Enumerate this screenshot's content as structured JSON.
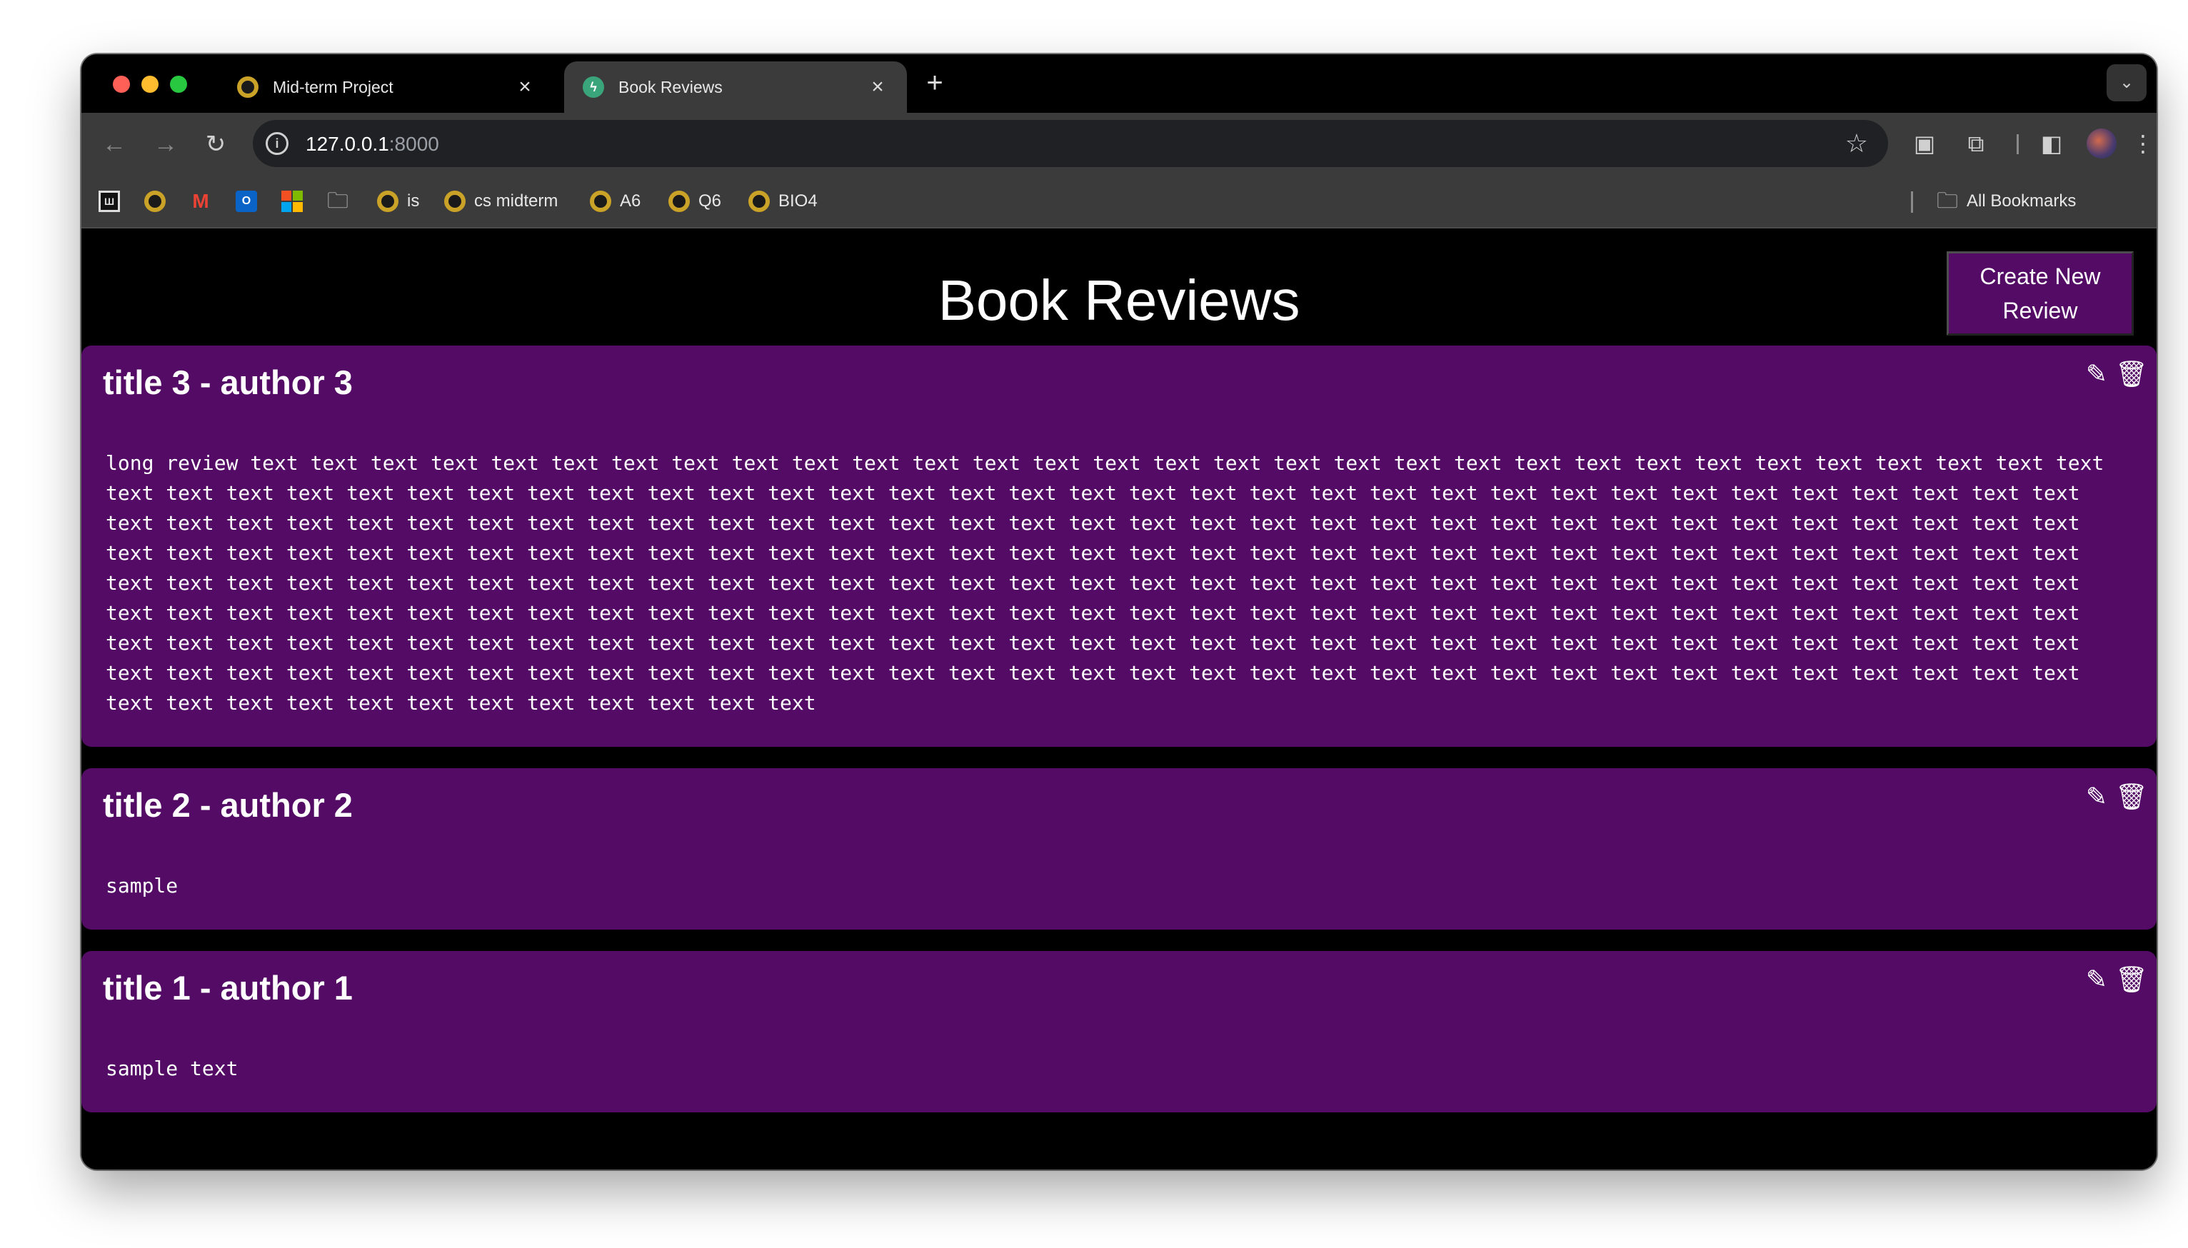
{
  "browser": {
    "tabs": [
      {
        "label": "Mid-term Project",
        "active": false,
        "icon": "ring-logo-icon"
      },
      {
        "label": "Book Reviews",
        "active": true,
        "icon": "bolt-icon"
      }
    ],
    "url_host": "127.0.0.1",
    "url_port": ":8000",
    "bookmarks": [
      {
        "label": "",
        "icon": "music-app-icon"
      },
      {
        "label": "",
        "icon": "ring-logo-icon"
      },
      {
        "label": "",
        "icon": "gmail-icon"
      },
      {
        "label": "",
        "icon": "outlook-icon"
      },
      {
        "label": "",
        "icon": "microsoft-icon"
      },
      {
        "label": "",
        "icon": "folder-icon"
      },
      {
        "label": "is",
        "icon": "ring-logo-icon"
      },
      {
        "label": "cs midterm",
        "icon": "ring-logo-icon"
      },
      {
        "label": "A6",
        "icon": "ring-logo-icon"
      },
      {
        "label": "Q6",
        "icon": "ring-logo-icon"
      },
      {
        "label": "BIO4",
        "icon": "ring-logo-icon"
      }
    ],
    "all_bookmarks_label": "All Bookmarks"
  },
  "page": {
    "title": "Book Reviews",
    "create_button_label": "Create New Review",
    "colors": {
      "background": "#000000",
      "card": "#530b65",
      "text": "#ffffff"
    },
    "reviews": [
      {
        "heading": "title 3 - author 3",
        "body": "long review text text text text text text text text text text text text text text text text text text text text text text text text text text text text text text text text text text text text text text text text text text text text text text text text text text text text text text text text text text text text text text text text text text text text text text text text text text text text text text text text text text text text text text text text text text text text text text text text text text text text text text text text text text text text text text text text text text text text text text text text text text text text text text text text text text text text text text text text text text text text text text text text text text text text text text text text text text text text text text text text text text text text text text text text text text text text text text text text text text text text text text text text text text text text text text text text text text text text text text text text text text text text text text text text text text text text text text text text text text text text text text text text text text text text text text text text text text text text text text text text text text text text text text text text text text text text text text text text text text text text text text text text text text text text text text text text text text"
      },
      {
        "heading": "title 2 - author 2",
        "body": "sample"
      },
      {
        "heading": "title 1 - author 1",
        "body": "sample text"
      }
    ]
  }
}
